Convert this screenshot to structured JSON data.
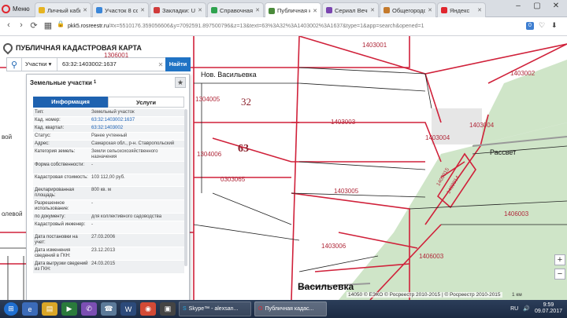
{
  "browser": {
    "menu_label": "Меню",
    "tabs": [
      {
        "label": "Личный каби",
        "color": "#e6b422"
      },
      {
        "label": "Участок 8 со",
        "color": "#3a86d8"
      },
      {
        "label": "Закладки: Uns",
        "color": "#d03b3b"
      },
      {
        "label": "Справочная н",
        "color": "#2fa34f"
      },
      {
        "label": "Публичная ка",
        "color": "#4a8a3b"
      },
      {
        "label": "Сериал Вечно",
        "color": "#7a45b0"
      },
      {
        "label": "Общегородск",
        "color": "#c47a2c"
      },
      {
        "label": "Яндекс",
        "color": "#e0262e"
      }
    ],
    "active_tab": 4,
    "url_host": "pkk5.rosreestr.ru",
    "url_rest": "/#x=5510176.359056606&y=7092591.897500796&z=13&text=63%3A32%3A1403002%3A1637&type=1&app=search&opened=1",
    "badge": "0"
  },
  "map": {
    "title": "ПУБЛИЧНАЯ КАДАСТРОВАЯ КАРТА",
    "labels": [
      {
        "text": "1306001"
      },
      {
        "text": "Нов. Васильевка"
      },
      {
        "text": "1304005"
      },
      {
        "text": "32"
      },
      {
        "text": "1403001"
      },
      {
        "text": "1403002"
      },
      {
        "text": "1403003"
      },
      {
        "text": "1403004"
      },
      {
        "text": "1403004"
      },
      {
        "text": "Рассвет"
      },
      {
        "text": "63"
      },
      {
        "text": "1304006"
      },
      {
        "text": "0303065"
      },
      {
        "text": "1403005"
      },
      {
        "text": "1406003"
      },
      {
        "text": "1403006"
      },
      {
        "text": "1406003"
      },
      {
        "text": "Васильевка"
      },
      {
        "text": "0303070"
      },
      {
        "text": "1403015"
      },
      {
        "text": "1403014"
      },
      {
        "text": "олевой"
      },
      {
        "text": "вой"
      }
    ],
    "copyright": "14050 © ЕЭКО © Росреестр 2010-2015 | © Росреестр 2010-2015",
    "scale": "1 км",
    "zoom_in": "+",
    "zoom_out": "−"
  },
  "search": {
    "type_label": "Участки",
    "query": "63:32:1403002:1637",
    "button": "Найти"
  },
  "panel": {
    "title": "Земельные участки",
    "title_sup": "1",
    "tabs": [
      "Информация",
      "Услуги"
    ],
    "rows": [
      {
        "k": "Тип:",
        "v": "Земельный участок",
        "link": false
      },
      {
        "k": "Кад. номер:",
        "v": "63:32:1403002:1637",
        "link": true
      },
      {
        "k": "Кад. квартал:",
        "v": "63:32:1403002",
        "link": true
      },
      {
        "k": "Статус:",
        "v": "Ранее учтенный",
        "link": false
      },
      {
        "k": "Адрес:",
        "v": "Самарская обл., р-н. Ставропольский",
        "link": false
      },
      {
        "k": "Категория земель:",
        "v": "Земли сельскохозяйственного назначения",
        "link": false
      },
      {
        "k": "Форма собственности:",
        "v": "-",
        "link": false
      },
      {
        "k": "Кадастровая стоимость:",
        "v": "103 112,00 руб.",
        "link": false
      },
      {
        "k": "Декларированная площадь:",
        "v": "800 кв. м",
        "link": false
      },
      {
        "k": "Разрешенное использование:",
        "v": "-",
        "link": false
      },
      {
        "k": "по документу:",
        "v": "для коллективного садоводства",
        "link": false
      },
      {
        "k": "Кадастровый инженер:",
        "v": "-",
        "link": false
      },
      {
        "k": "Дата постановки на учет:",
        "v": "27.03.2006",
        "link": false
      },
      {
        "k": "Дата изменения сведений в ГКН:",
        "v": "23.12.2013",
        "link": false
      },
      {
        "k": "Дата выгрузки сведений из ГКН:",
        "v": "24.03.2015",
        "link": false
      }
    ]
  },
  "taskbar": {
    "apps": [
      {
        "label": "Skype™ - alexsan..."
      },
      {
        "label": "Публичная кадас..."
      }
    ],
    "lang": "RU",
    "time": "9:59",
    "date": "09.07.2017"
  }
}
